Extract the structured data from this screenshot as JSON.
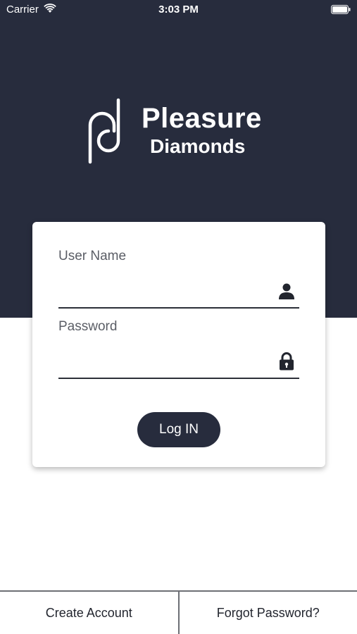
{
  "status_bar": {
    "carrier": "Carrier",
    "time": "3:03 PM"
  },
  "logo": {
    "line1": "Pleasure",
    "line2": "Diamonds"
  },
  "form": {
    "username_label": "User Name",
    "username_value": "",
    "username_icon": "person-icon",
    "password_label": "Password",
    "password_value": "",
    "password_icon": "lock-icon",
    "login_label": "Log IN"
  },
  "bottom_bar": {
    "create_account_label": "Create Account",
    "forgot_password_label": "Forgot Password?"
  },
  "colors": {
    "header_background": "#272c3d",
    "button_background": "#272c3d",
    "page_background": "#ffffff"
  }
}
